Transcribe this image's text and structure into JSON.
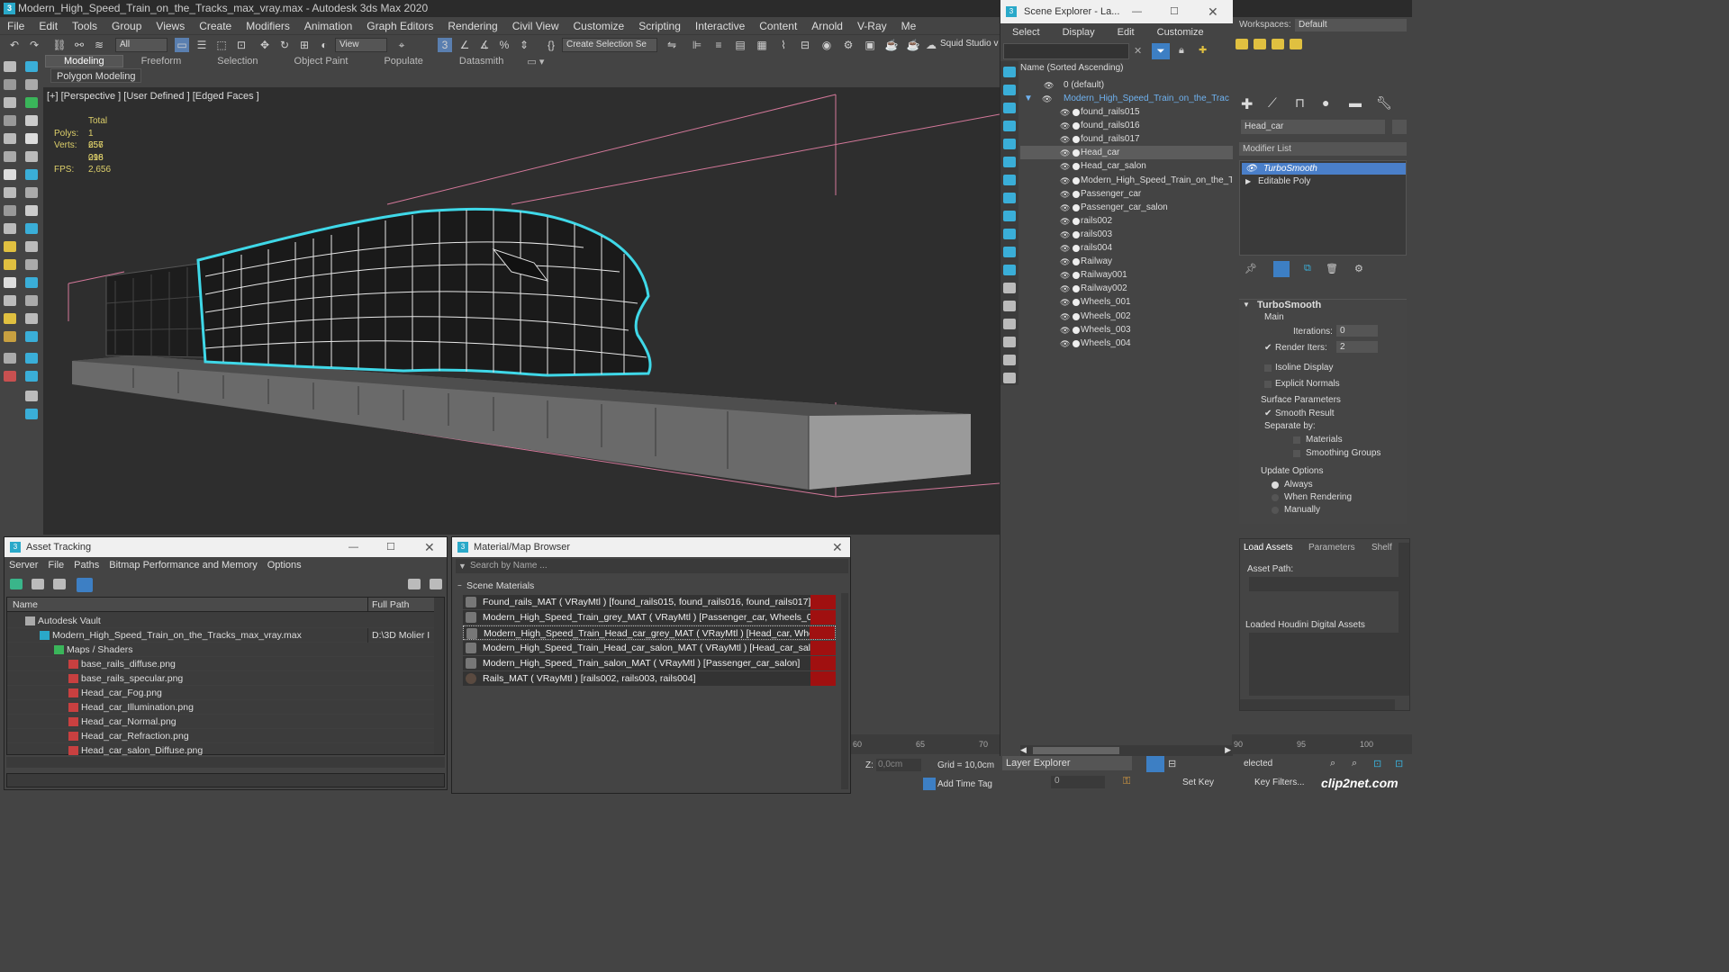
{
  "titlebar": {
    "app_icon": "3",
    "title": "Modern_High_Speed_Train_on_the_Tracks_max_vray.max - Autodesk 3ds Max 2020"
  },
  "menubar": [
    "File",
    "Edit",
    "Tools",
    "Group",
    "Views",
    "Create",
    "Modifiers",
    "Animation",
    "Graph Editors",
    "Rendering",
    "Civil View",
    "Customize",
    "Scripting",
    "Interactive",
    "Content",
    "Arnold",
    "V-Ray",
    "Me"
  ],
  "toolbar": {
    "filter": "All",
    "view": "View",
    "selection_set": "Create Selection Se",
    "squid": "Squid Studio v"
  },
  "ribbon": {
    "tabs": [
      "Modeling",
      "Freeform",
      "Selection",
      "Object Paint",
      "Populate",
      "Datasmith"
    ],
    "active": "Modeling",
    "panel": "Polygon Modeling"
  },
  "viewport": {
    "label": "[+] [Perspective ] [User Defined ] [Edged Faces ]",
    "stats_total": "Total",
    "polys_label": "Polys:",
    "polys_value": "1 257 216",
    "verts_label": "Verts:",
    "verts_value": "656 098",
    "fps_label": "FPS:",
    "fps_value": "2,656"
  },
  "workspaces": {
    "label": "Workspaces:",
    "value": "Default"
  },
  "scene_explorer": {
    "title": "Scene Explorer - La...",
    "menu": [
      "Select",
      "Display",
      "Edit",
      "Customize"
    ],
    "header": "Name (Sorted Ascending)",
    "layer": "0 (default)",
    "parent": "Modern_High_Speed_Train_on_the_Trac",
    "items": [
      "found_rails015",
      "found_rails016",
      "found_rails017",
      "Head_car",
      "Head_car_salon",
      "Modern_High_Speed_Train_on_the_T",
      "Passenger_car",
      "Passenger_car_salon",
      "rails002",
      "rails003",
      "rails004",
      "Railway",
      "Railway001",
      "Railway002",
      "Wheels_001",
      "Wheels_002",
      "Wheels_003",
      "Wheels_004"
    ],
    "selected": "Head_car",
    "layer_explorer": "Layer Explorer"
  },
  "command_panel": {
    "object_name": "Head_car",
    "modifier_list": "Modifier List",
    "stack": [
      "TurboSmooth",
      "Editable Poly"
    ],
    "rollout_title": "TurboSmooth",
    "main": "Main",
    "iterations_label": "Iterations:",
    "iterations_value": "0",
    "render_iters_label": "Render Iters:",
    "render_iters_value": "2",
    "isoline": "Isoline Display",
    "explicit_normals": "Explicit Normals",
    "surface_params": "Surface Parameters",
    "smooth_result": "Smooth Result",
    "separate_by": "Separate by:",
    "materials": "Materials",
    "smoothing_groups": "Smoothing Groups",
    "update_options": "Update Options",
    "always": "Always",
    "when_rendering": "When Rendering",
    "manually": "Manually",
    "tabs": [
      "Load Assets",
      "Parameters",
      "Shelf"
    ],
    "asset_path": "Asset Path:",
    "loaded_houdini": "Loaded Houdini Digital Assets"
  },
  "asset_tracking": {
    "title": "Asset Tracking",
    "menu": [
      "Server",
      "File",
      "Paths",
      "Bitmap Performance and Memory",
      "Options"
    ],
    "col_name": "Name",
    "col_path": "Full Path",
    "rows": [
      {
        "name": "Autodesk Vault",
        "path": ""
      },
      {
        "name": "Modern_High_Speed_Train_on_the_Tracks_max_vray.max",
        "path": "D:\\3D Molier I"
      },
      {
        "name": "Maps / Shaders",
        "path": ""
      },
      {
        "name": "base_rails_diffuse.png",
        "path": ""
      },
      {
        "name": "base_rails_specular.png",
        "path": ""
      },
      {
        "name": "Head_car_Fog.png",
        "path": ""
      },
      {
        "name": "Head_car_Illumination.png",
        "path": ""
      },
      {
        "name": "Head_car_Normal.png",
        "path": ""
      },
      {
        "name": "Head_car_Refraction.png",
        "path": ""
      },
      {
        "name": "Head_car_salon_Diffuse.png",
        "path": ""
      }
    ]
  },
  "material_browser": {
    "title": "Material/Map Browser",
    "search": "Search by Name ...",
    "section": "Scene Materials",
    "rows": [
      "Found_rails_MAT ( VRayMtl ) [found_rails015, found_rails016, found_rails017]",
      "Modern_High_Speed_Train_grey_MAT ( VRayMtl ) [Passenger_car, Wheels_003...",
      "Modern_High_Speed_Train_Head_car_grey_MAT ( VRayMtl ) [Head_car, Wheel...",
      "Modern_High_Speed_Train_Head_car_salon_MAT ( VRayMtl ) [Head_car_salon]",
      "Modern_High_Speed_Train_salon_MAT ( VRayMtl ) [Passenger_car_salon]",
      "Rails_MAT ( VRayMtl ) [rails002, rails003, rails004]"
    ]
  },
  "timeline": [
    "60",
    "65",
    "70"
  ],
  "timeline_right": [
    "90",
    "95",
    "100"
  ],
  "status": {
    "z_label": "Z:",
    "z_value": "0,0cm",
    "grid": "Grid = 10,0cm",
    "add_time_tag": "Add Time Tag",
    "set_key": "Set Key",
    "key_filters": "Key Filters...",
    "selected": "elected",
    "frame": "0",
    "watermark": "clip2net.com"
  },
  "colors": {
    "selection_cyan": "#3fd8e8",
    "material_red": "#a01010",
    "stack_highlight": "#4a7fc9"
  }
}
